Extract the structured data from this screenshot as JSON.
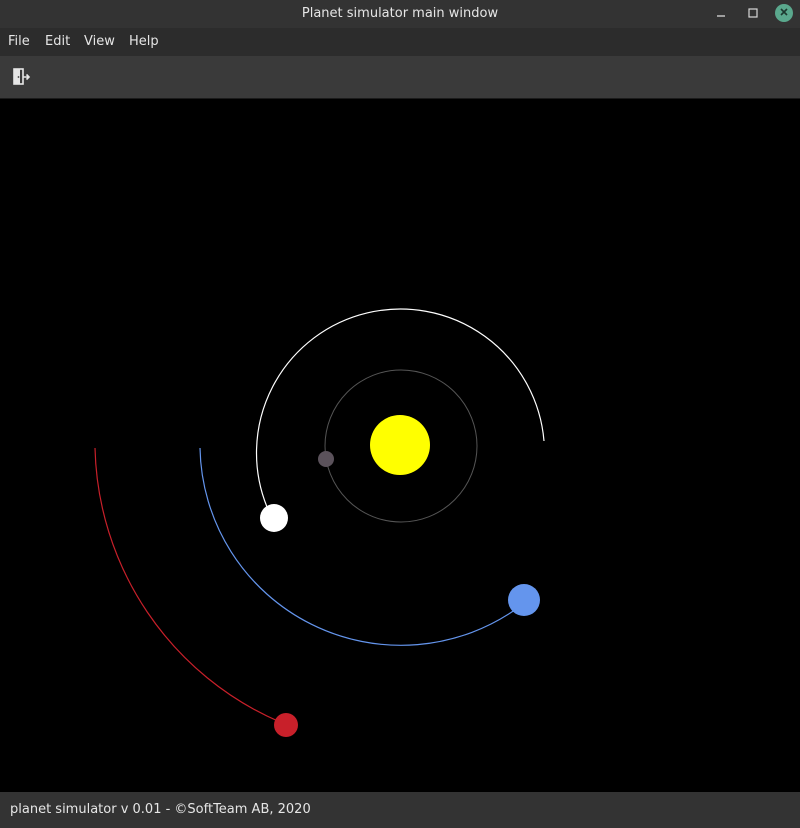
{
  "window": {
    "title": "Planet simulator main window",
    "min_glyph": "–",
    "max_glyph": "☐",
    "close_glyph": "✕"
  },
  "menu": {
    "items": [
      {
        "label": "File"
      },
      {
        "label": "Edit"
      },
      {
        "label": "View"
      },
      {
        "label": "Help"
      }
    ]
  },
  "toolbar": {
    "exit_icon": "exit-icon"
  },
  "simulation": {
    "background": "#000000",
    "sun": {
      "name": "sun",
      "color": "#ffff00"
    },
    "planets": [
      {
        "name": "inner-planet",
        "color": "#5b525b",
        "orbit_color": "#555555"
      },
      {
        "name": "white-planet",
        "color": "#ffffff",
        "orbit_color": "#ffffff"
      },
      {
        "name": "blue-planet",
        "color": "#6495ed",
        "orbit_color": "#6495ed"
      },
      {
        "name": "red-planet",
        "color": "#c8202a",
        "orbit_color": "#c8202a"
      }
    ]
  },
  "status": {
    "text": "planet simulator v 0.01 - ©SoftTeam AB, 2020"
  }
}
